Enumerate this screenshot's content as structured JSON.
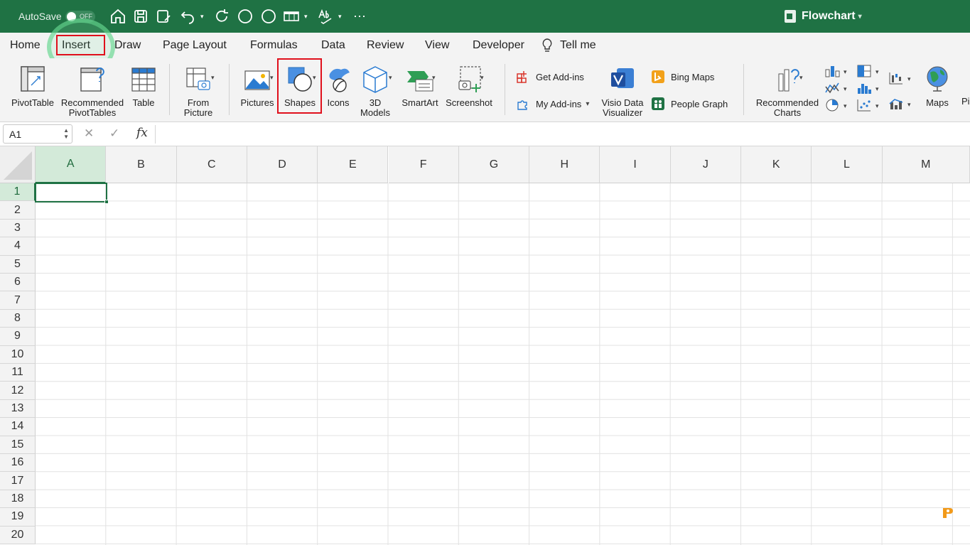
{
  "titlebar": {
    "autosave_label": "AutoSave",
    "autosave_state": "OFF",
    "document_title": "Flowchart",
    "bg_color": "#1f7244"
  },
  "tabs": [
    {
      "label": "Home"
    },
    {
      "label": "Insert",
      "active": true
    },
    {
      "label": "Draw"
    },
    {
      "label": "Page Layout"
    },
    {
      "label": "Formulas"
    },
    {
      "label": "Data"
    },
    {
      "label": "Review"
    },
    {
      "label": "View"
    },
    {
      "label": "Developer"
    },
    {
      "label": "Tell me"
    }
  ],
  "ribbon": {
    "pivottable": "PivotTable",
    "rec_pivot_1": "Recommended",
    "rec_pivot_2": "PivotTables",
    "table": "Table",
    "from_picture_1": "From",
    "from_picture_2": "Picture",
    "pictures": "Pictures",
    "shapes": "Shapes",
    "icons": "Icons",
    "models_1": "3D",
    "models_2": "Models",
    "smartart": "SmartArt",
    "screenshot": "Screenshot",
    "get_addins": "Get Add-ins",
    "my_addins": "My Add-ins",
    "visio_1": "Visio Data",
    "visio_2": "Visualizer",
    "bing_maps": "Bing Maps",
    "people_graph": "People Graph",
    "rec_charts_1": "Recommended",
    "rec_charts_2": "Charts",
    "maps": "Maps",
    "pi_cut": "Pi"
  },
  "formula_bar": {
    "name_box": "A1",
    "fx": "fx",
    "value": ""
  },
  "grid": {
    "columns": [
      "A",
      "B",
      "C",
      "D",
      "E",
      "F",
      "G",
      "H",
      "I",
      "J",
      "K",
      "L",
      "M"
    ],
    "rows": [
      "1",
      "2",
      "3",
      "4",
      "5",
      "6",
      "7",
      "8",
      "9",
      "10",
      "11",
      "12",
      "13",
      "14",
      "15",
      "16",
      "17",
      "18",
      "19",
      "20"
    ],
    "active_cell": "A1"
  },
  "colors": {
    "accent": "#1f7244",
    "highlight_box": "#e0101c"
  }
}
